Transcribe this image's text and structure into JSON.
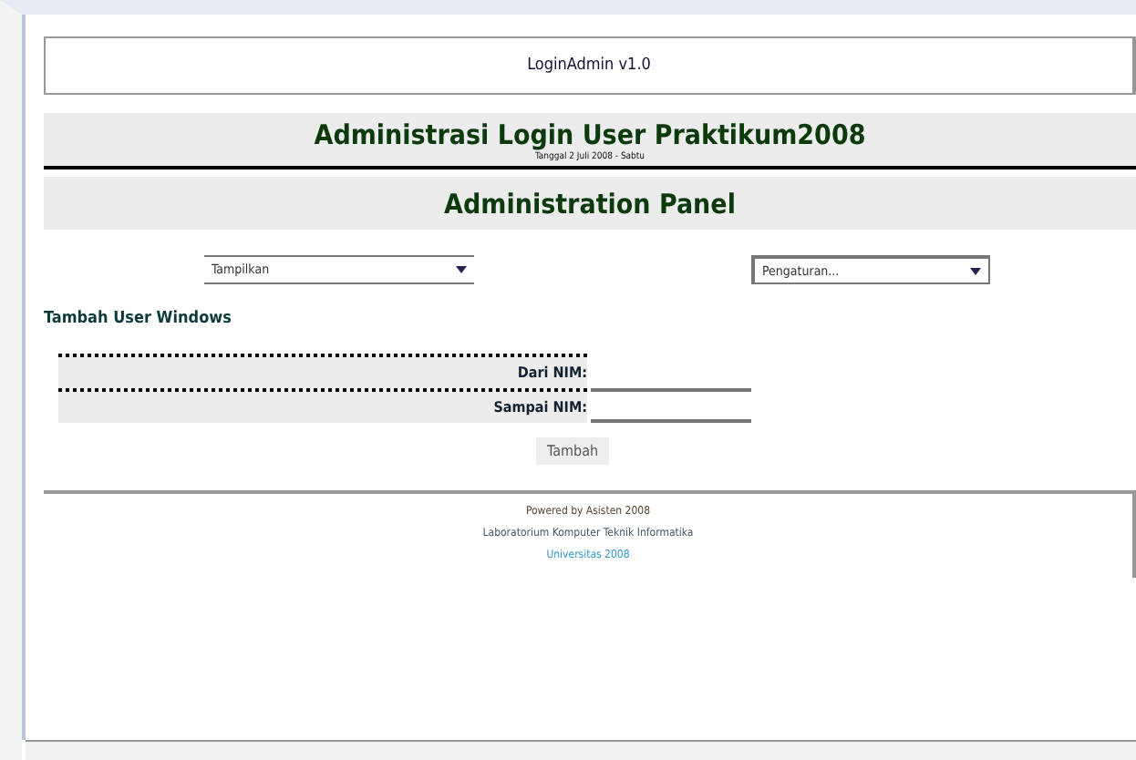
{
  "app_title": "LoginAdmin v1.0",
  "header": {
    "title": "Administrasi Login User Praktikum2008",
    "subtitle": "Tanggal 2 Juli 2008 - Sabtu"
  },
  "panel_title": "Administration Panel",
  "dropdowns": [
    {
      "value": "Tampilkan"
    },
    {
      "value": "Pengaturan..."
    }
  ],
  "section_title": "Tambah User Windows",
  "form_fields": [
    {
      "label": "Dari NIM:"
    },
    {
      "label": "Sampai NIM:"
    }
  ],
  "submit_button": "Tambah",
  "footer": [
    "Powered by Asisten 2008",
    "Laboratorium Komputer Teknik Informatika",
    "Universitas 2008"
  ]
}
